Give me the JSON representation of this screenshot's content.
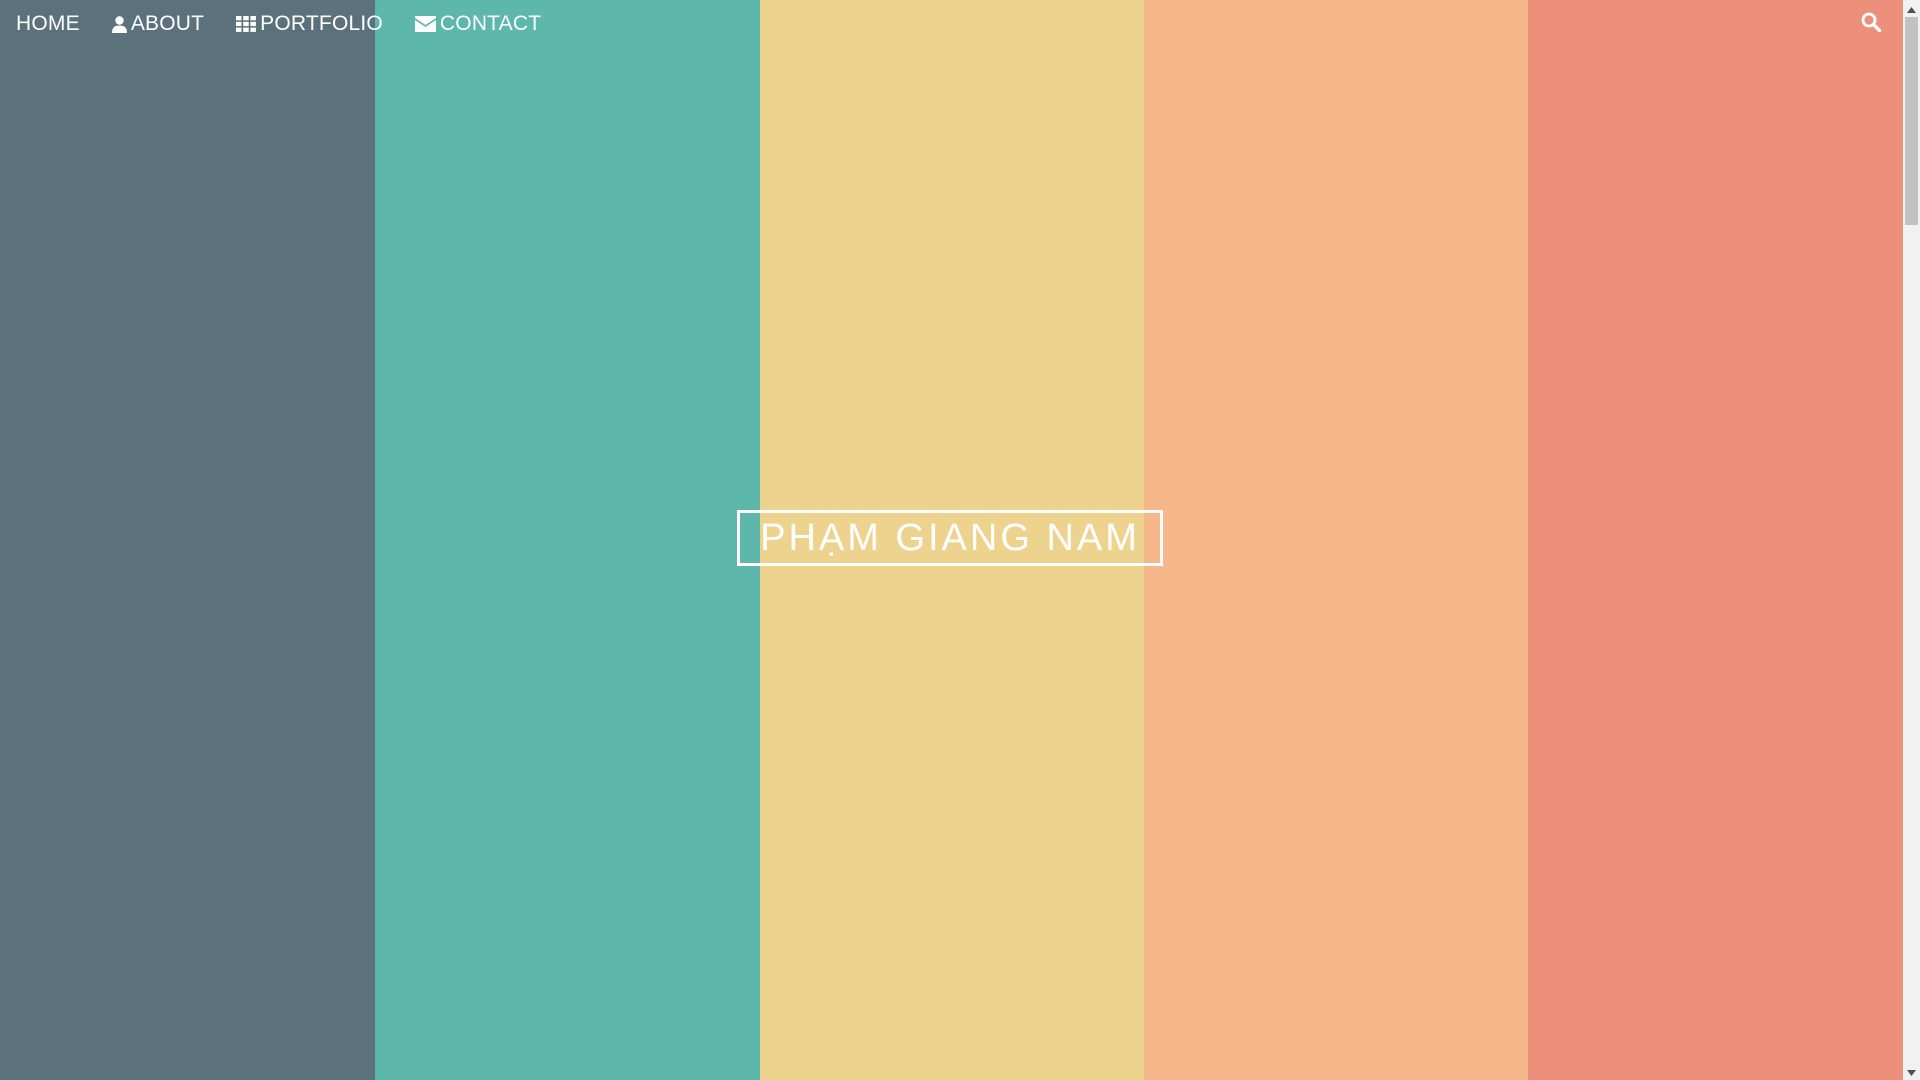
{
  "colors": {
    "stripes": [
      "#5b717b",
      "#5eb7ab",
      "#eed38f",
      "#f6b88a",
      "#ec907b"
    ],
    "nav_text": "#ffffff",
    "title_text": "#ffffff"
  },
  "nav": {
    "items": [
      {
        "label": "HOME",
        "icon": ""
      },
      {
        "label": "ABOUT",
        "icon": "user-icon"
      },
      {
        "label": "PORTFOLIO",
        "icon": "grid-icon"
      },
      {
        "label": "CONTACT",
        "icon": "envelope-icon"
      }
    ],
    "search_icon": "search-icon"
  },
  "hero": {
    "title": "PHẠM GIANG NAM"
  },
  "scrollbar": {
    "up_icon": "arrow-up-icon",
    "down_icon": "arrow-down-icon"
  }
}
